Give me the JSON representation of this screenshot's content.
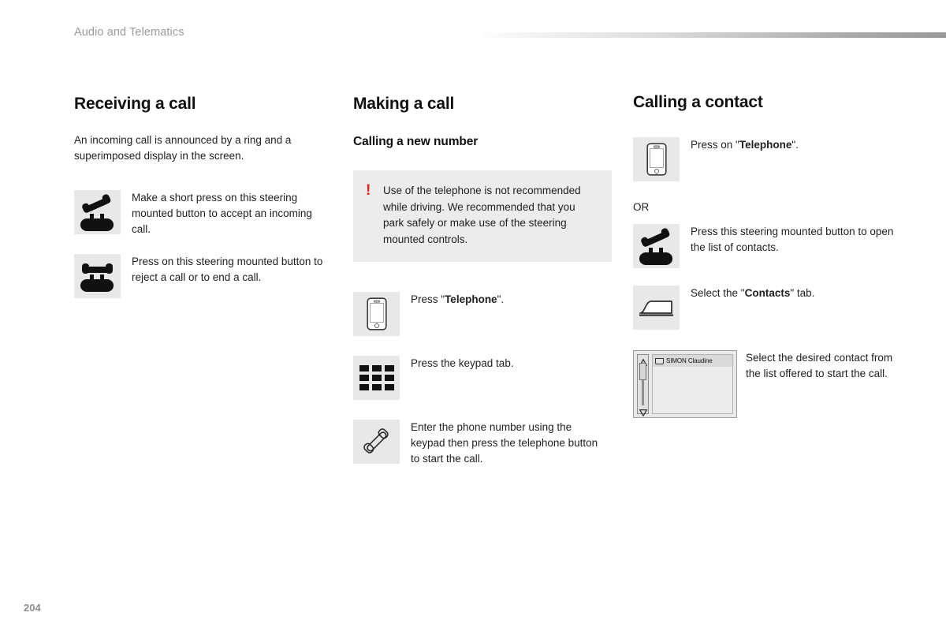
{
  "header": {
    "title": "Audio and Telematics"
  },
  "footer": {
    "page_number": "204"
  },
  "columns": {
    "left": {
      "title": "Receiving a call",
      "intro": "An incoming call is announced by a ring and a superimposed display in the screen.",
      "rows": [
        {
          "icon": "steering-wheel-accept-call-icon",
          "text": "Make a short press on this steering mounted button to accept an incoming call."
        },
        {
          "icon": "steering-wheel-end-call-icon",
          "text": "Press on this steering mounted button to reject a call or to end a call."
        }
      ]
    },
    "middle": {
      "title": "Making a call",
      "subtitle": "Calling a new number",
      "warning": {
        "symbol": "!",
        "symbol_color": "#e2231a",
        "text": "Use of the telephone is not recommended while driving. We recommended that you park safely or make use of the steering mounted controls."
      },
      "rows": [
        {
          "icon": "smartphone-icon",
          "text_before": "Press \"",
          "text_bold": "Telephone",
          "text_after": "\"."
        },
        {
          "icon": "keypad-grid-icon",
          "text_before": "Press the keypad tab.",
          "text_bold": "",
          "text_after": ""
        },
        {
          "icon": "handset-icon",
          "text_before": "Enter the phone number using the keypad then press the telephone button to start the call.",
          "text_bold": "",
          "text_after": ""
        }
      ]
    },
    "right": {
      "title": "Calling a contact",
      "or_label": "OR",
      "rows": [
        {
          "icon": "smartphone-icon",
          "text_before": "Press on \"",
          "text_bold": "Telephone",
          "text_after": "\"."
        },
        {
          "icon": "steering-wheel-accept-call-icon",
          "text_before": "Press this steering mounted button to open the list of contacts.",
          "text_bold": "",
          "text_after": ""
        },
        {
          "icon": "contacts-tab-icon",
          "text_before": "Select the \"",
          "text_bold": "Contacts",
          "text_after": "\" tab."
        },
        {
          "icon": "contacts-list-screen",
          "text_before": "Select the desired contact from the list offered to start the call.",
          "text_bold": "",
          "text_after": ""
        }
      ],
      "contacts_screen": {
        "contact_name": "SIMON Claudine"
      }
    }
  }
}
